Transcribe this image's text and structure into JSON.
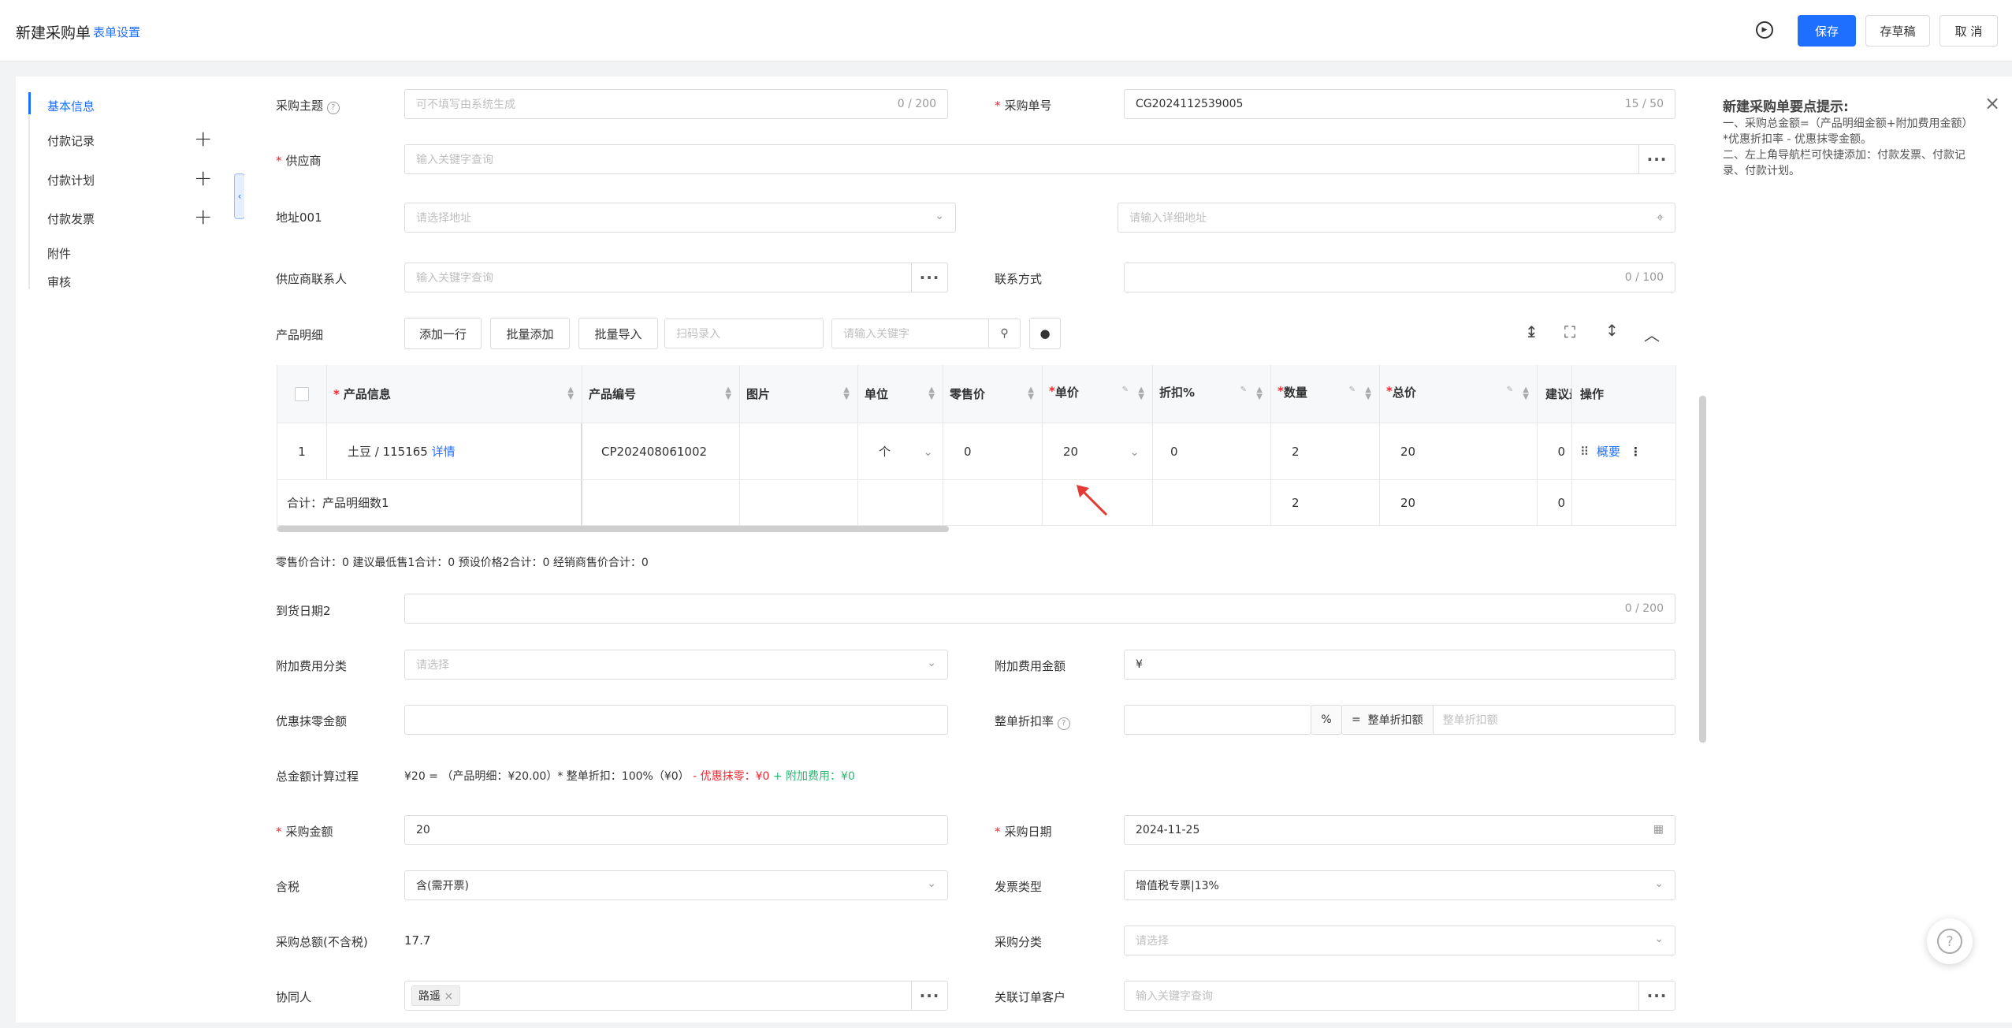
{
  "header": {
    "title": "新建采购单",
    "settings_link": "表单设置",
    "save": "保存",
    "draft": "存草稿",
    "cancel": "取 消"
  },
  "nav": {
    "items": [
      "基本信息",
      "付款记录",
      "付款计划",
      "付款发票",
      "附件",
      "审核"
    ]
  },
  "form": {
    "subject": {
      "label": "采购主题",
      "placeholder": "可不填写由系统生成",
      "count": "0 / 200"
    },
    "order_no": {
      "label": "采购单号",
      "value": "CG2024112539005",
      "count": "15 / 50"
    },
    "supplier": {
      "label": "供应商",
      "placeholder": "输入关键字查询"
    },
    "address": {
      "label": "地址001",
      "placeholder": "请选择地址",
      "detail_placeholder": "请输入详细地址"
    },
    "contact": {
      "label": "供应商联系人",
      "placeholder": "输入关键字查询"
    },
    "contact_way": {
      "label": "联系方式",
      "count": "0 / 100"
    },
    "product": {
      "label": "产品明细",
      "add_row": "添加一行",
      "batch_add": "批量添加",
      "batch_import": "批量导入",
      "scan_placeholder": "扫码录入",
      "search_placeholder": "请输入关键字"
    },
    "arrival": {
      "label": "到货日期2",
      "count": "0 / 200"
    },
    "extra_cat": {
      "label": "附加费用分类",
      "placeholder": "请选择"
    },
    "extra_amt": {
      "label": "附加费用金额",
      "value": "¥"
    },
    "discount_off": {
      "label": "优惠抹零金额"
    },
    "whole_rate": {
      "label": "整单折扣率",
      "pct": "%",
      "eq": "=",
      "eq_label": "整单折扣额",
      "placeholder": "整单折扣额"
    },
    "calc": {
      "label": "总金额计算过程",
      "text1": "¥20 = （产品明细：¥20.00）* 整单折扣：100%（¥0）",
      "text2": "- 优惠抹零：¥0",
      "text3": "+ 附加费用：¥0"
    },
    "amount": {
      "label": "采购金额",
      "value": "20"
    },
    "date": {
      "label": "采购日期",
      "value": "2024-11-25"
    },
    "tax": {
      "label": "含税",
      "value": "含(需开票)"
    },
    "invoice_type": {
      "label": "发票类型",
      "value": "增值税专票|13%"
    },
    "total_ex": {
      "label": "采购总额(不含税)",
      "value": "17.7"
    },
    "category": {
      "label": "采购分类",
      "placeholder": "请选择"
    },
    "collab": {
      "label": "协同人",
      "tag": "路遥"
    },
    "customer": {
      "label": "关联订单客户",
      "placeholder": "输入关键字查询"
    }
  },
  "table": {
    "headers": [
      "产品信息",
      "产品编号",
      "图片",
      "单位",
      "零售价",
      "单价",
      "折扣%",
      "数量",
      "总价",
      "建议最",
      "操作"
    ],
    "row": {
      "idx": "1",
      "product": "土豆 / 115165",
      "detail": "详情",
      "code": "CP202408061002",
      "unit": "个",
      "retail": "0",
      "price": "20",
      "discount": "0",
      "qty": "2",
      "total": "20",
      "suggest": "0",
      "summary": "概要"
    },
    "sum": {
      "label": "合计：产品明细数1",
      "qty": "2",
      "total": "20",
      "suggest": "0"
    },
    "totals_line": "零售价合计：0  建议最低售1合计：0  预设价格2合计：0  经销商售价合计：0"
  },
  "tips": {
    "title": "新建采购单要点提示:",
    "line1": "一、采购总金额=（产品明细金额+附加费用金额）*优惠折扣率 - 优惠抹零金额。",
    "line2": "二、左上角导航栏可快捷添加：付款发票、付款记录、付款计划。"
  },
  "colors": {
    "primary": "#1f6fff",
    "danger": "#f5222d",
    "success": "#2bb673"
  }
}
